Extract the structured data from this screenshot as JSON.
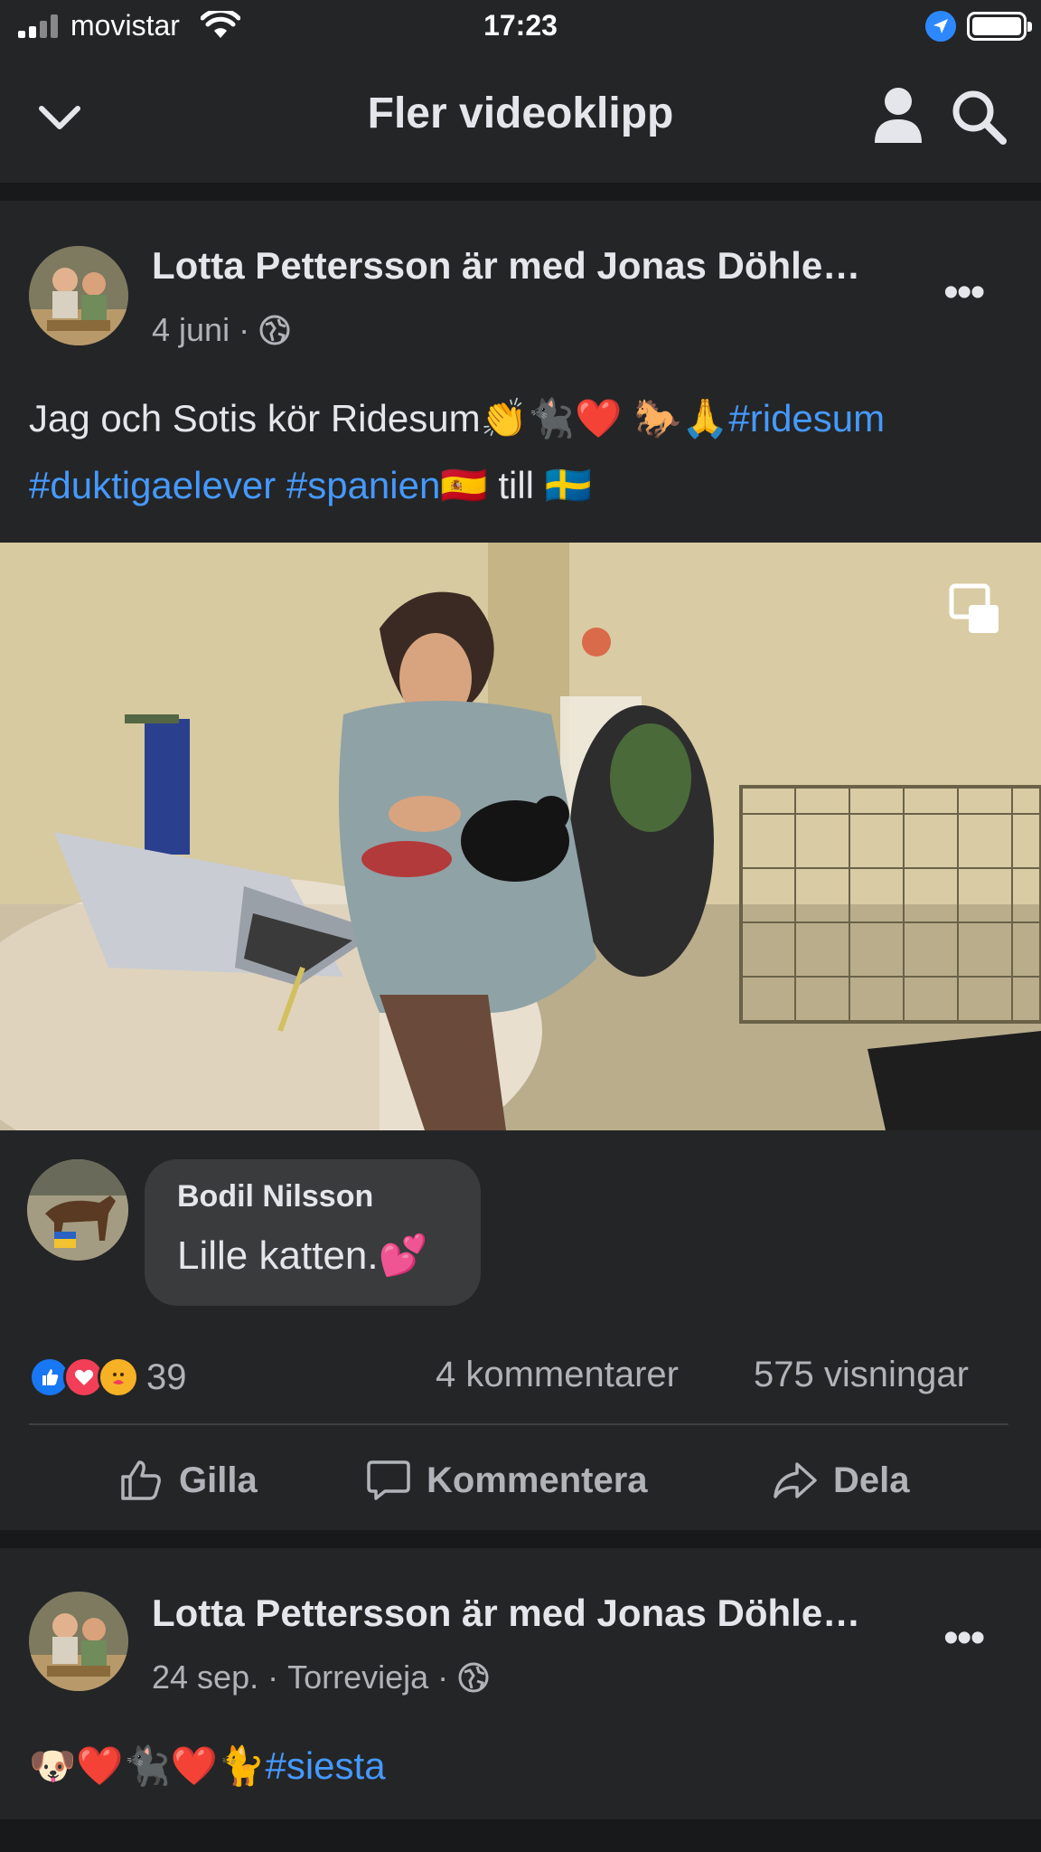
{
  "status_bar": {
    "carrier": "movistar",
    "time": "17:23"
  },
  "header": {
    "title": "Fler videoklipp"
  },
  "post1": {
    "author": "Lotta Pettersson är med Jonas Döhle…",
    "date": "4 juni",
    "dot": "·",
    "text_plain_1": "Jag och Sotis kör Ridesum",
    "emojis_1": "👏🐈‍⬛❤️ 🐎🙏",
    "tag_ridesum": "#ridesum",
    "tag_duktigaelever": "#duktigaelever",
    "tag_spanien": "#spanien",
    "flag_es": "🇪🇸",
    "text_till": "till",
    "flag_se": "🇸🇪",
    "comment": {
      "author": "Bodil Nilsson",
      "text": "Lille katten.💕"
    },
    "reactions_count": "39",
    "comments_count": "4 kommentarer",
    "views_count": "575 visningar",
    "actions": {
      "like": "Gilla",
      "comment": "Kommentera",
      "share": "Dela"
    }
  },
  "post2": {
    "author": "Lotta Pettersson är med Jonas Döhle…",
    "date": "24 sep.",
    "dot": "·",
    "location": "Torrevieja",
    "emojis": "🐶❤️🐈‍⬛❤️🐈",
    "tag_siesta": "#siesta"
  },
  "colors": {
    "accent": "#4599ff",
    "background": "#18191a",
    "card": "#242526",
    "bubble": "#3a3b3c"
  }
}
